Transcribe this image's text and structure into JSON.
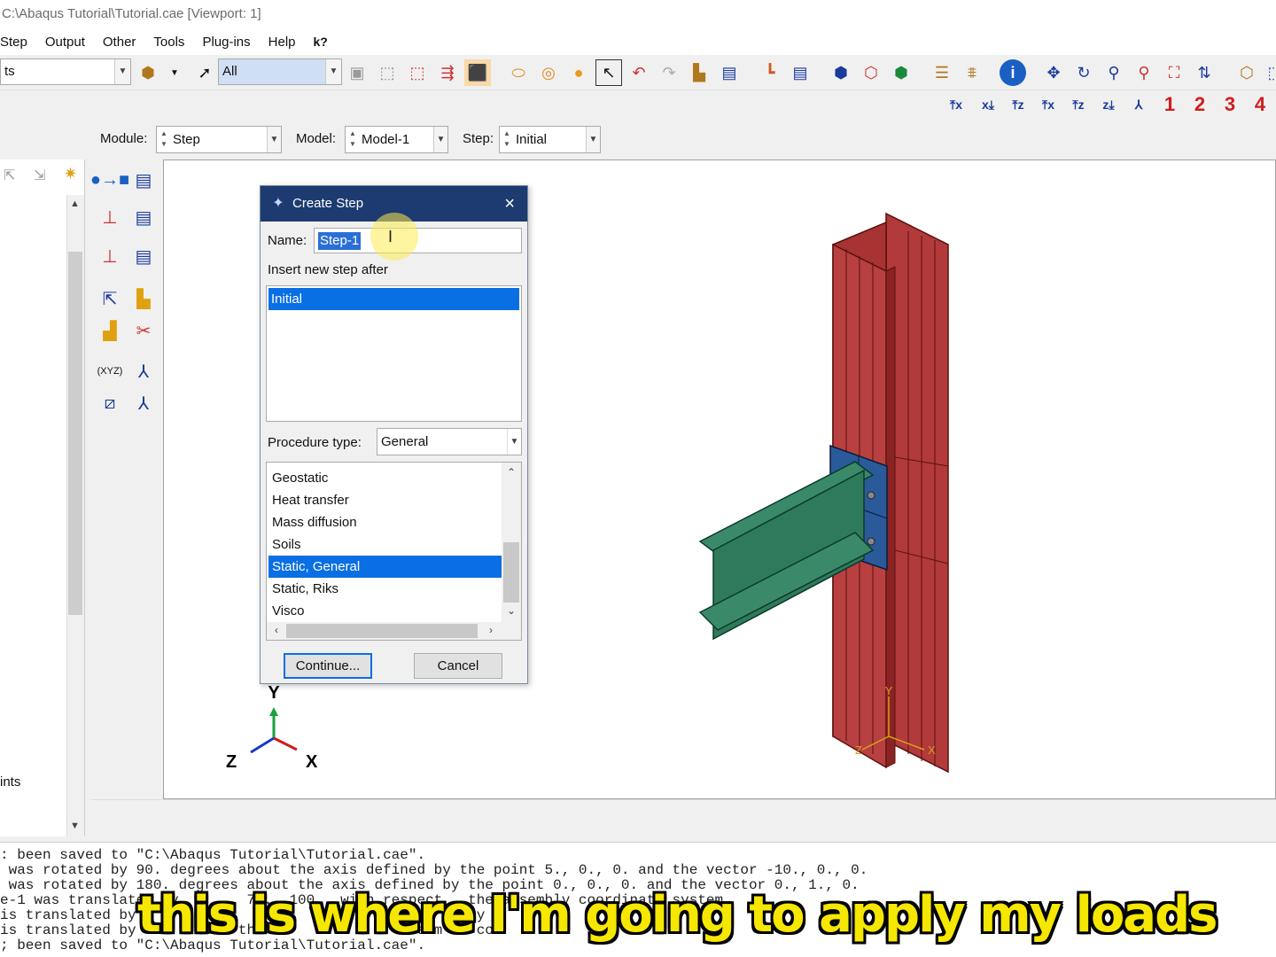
{
  "window": {
    "title": "C:\\Abaqus Tutorial\\Tutorial.cae [Viewport: 1]"
  },
  "menu": [
    "Step",
    "Output",
    "Other",
    "Tools",
    "Plug-ins",
    "Help"
  ],
  "menu_help_icon": "k?",
  "toolbar": {
    "left_combo_value": "ts",
    "selection_filter_value": "All",
    "view_numbers": [
      "1",
      "2",
      "3",
      "4"
    ]
  },
  "context": {
    "module_label": "Module:",
    "module_value": "Step",
    "model_label": "Model:",
    "model_value": "Model-1",
    "step_label": "Step:",
    "step_value": "Initial"
  },
  "left_tree": {
    "visible_label": "ints"
  },
  "dialog": {
    "title": "Create Step",
    "name_label": "Name:",
    "name_value": "Step-1",
    "insert_after_label": "Insert new step after",
    "insert_after_items": [
      "Initial"
    ],
    "procedure_type_label": "Procedure type:",
    "procedure_type_value": "General",
    "procedures": [
      "Geostatic",
      "Heat transfer",
      "Mass diffusion",
      "Soils",
      "Static, General",
      "Static, Riks",
      "Visco"
    ],
    "selected_procedure": "Static, General",
    "continue_label": "Continue...",
    "cancel_label": "Cancel"
  },
  "triad": {
    "y": "Y",
    "z": "Z",
    "x": "X"
  },
  "model_triad": {
    "y": "Y",
    "z": "Z",
    "x": "X"
  },
  "messages": [
    ": been saved to \"C:\\Abaqus Tutorial\\Tutorial.cae\".",
    " was rotated by 90. degrees about the axis defined by the point 5., 0., 0. and the vector -10., 0., 0.",
    " was rotated by 180. degrees about the axis defined by the point 0., 0., 0. and the vector 0., 1., 0.",
    "e-1 was translated by      , 70., 100.  with respect   the assembly coordinate system",
    "is translated by                                        y",
    "is translated by       5.   th                  ssem    co",
    "; been saved to \"C:\\Abaqus Tutorial\\Tutorial.cae\"."
  ],
  "subtitle": "this is where I'm going to apply my loads",
  "colors": {
    "column": "#b23a3a",
    "beam": "#3a8a6a",
    "plate": "#2a5a9a",
    "selection": "#0a6ee4",
    "dialog_title": "#1d3b70",
    "subtitle": "#f5e700"
  }
}
